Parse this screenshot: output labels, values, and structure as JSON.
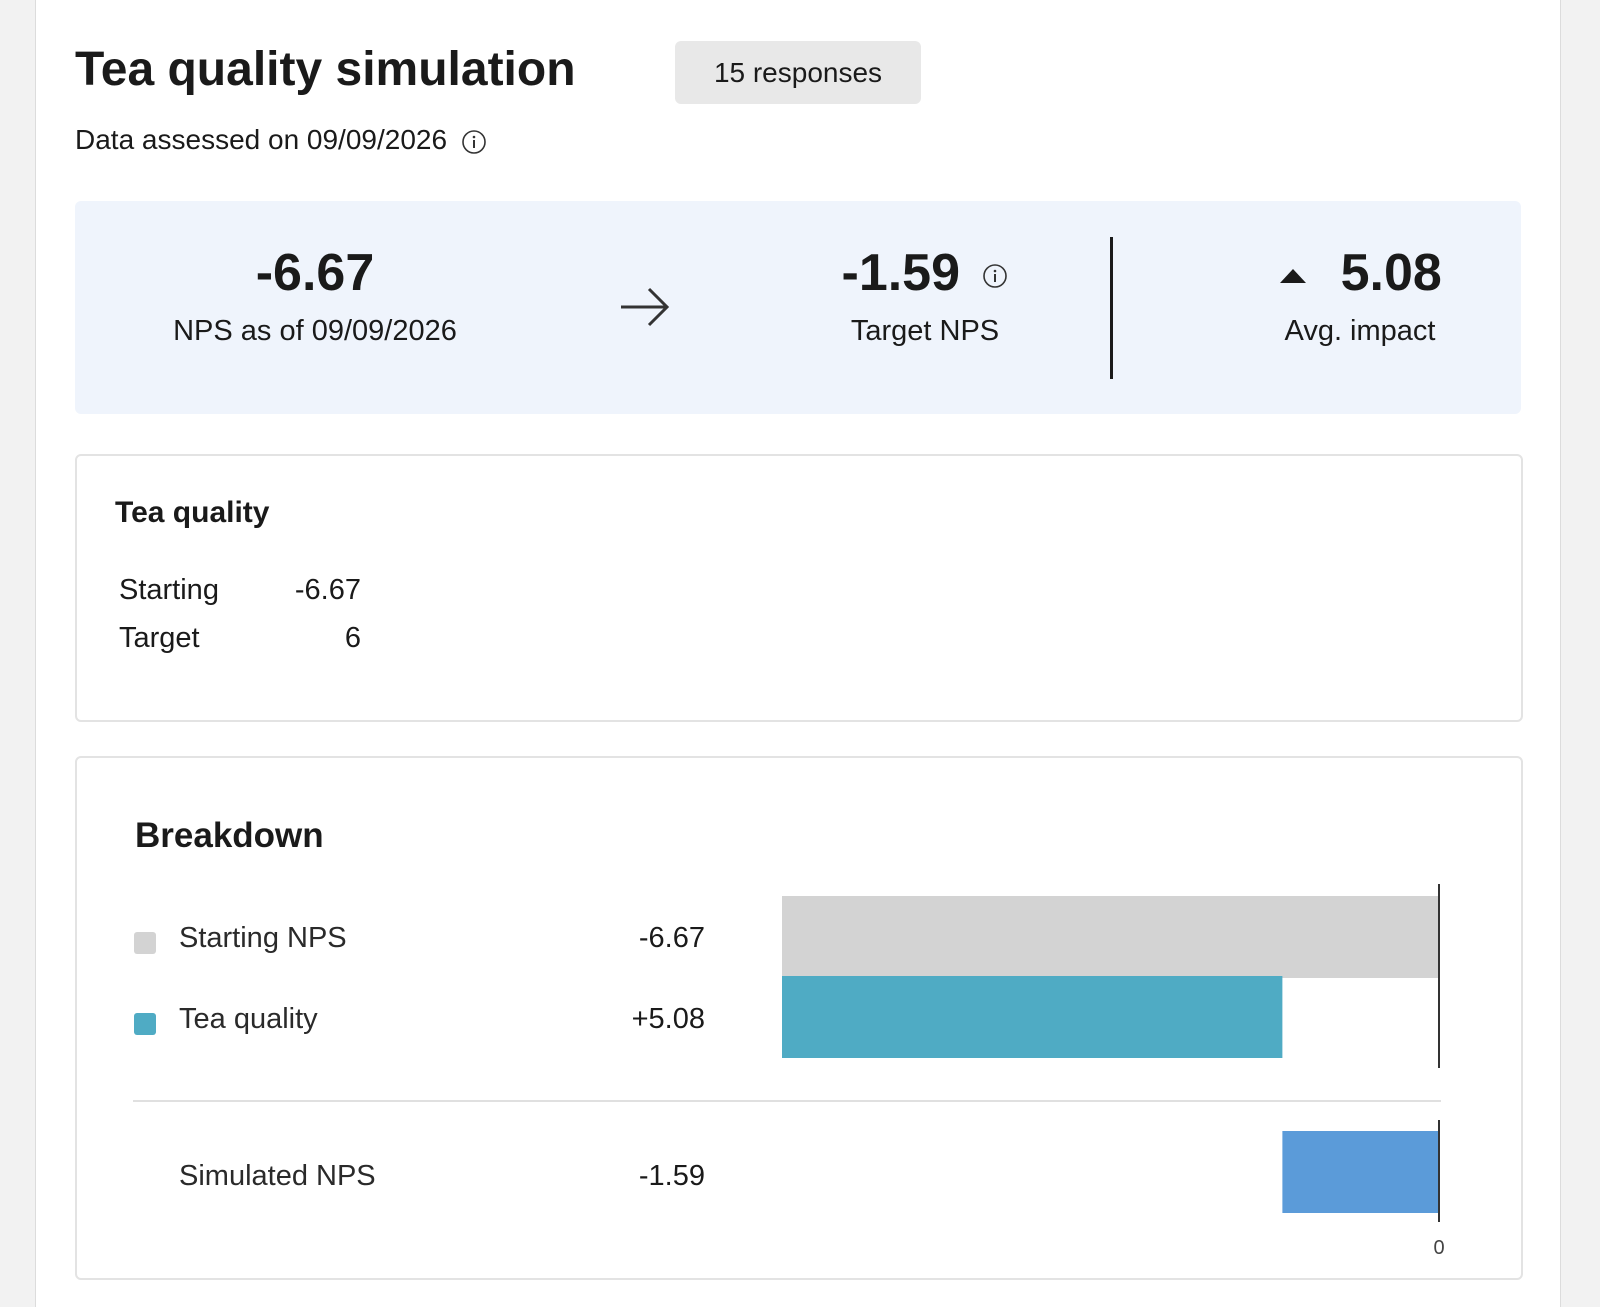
{
  "page": {
    "title": "Tea quality simulation",
    "responses_badge": "15 responses",
    "assessed_text": "Data assessed on 09/09/2026"
  },
  "summary": {
    "starting": {
      "value": "-6.67",
      "label": "NPS as of 09/09/2026"
    },
    "target": {
      "value": "-1.59",
      "label": "Target NPS"
    },
    "impact": {
      "value": "5.08",
      "label": "Avg. impact"
    }
  },
  "driver_card": {
    "title": "Tea quality",
    "rows": [
      {
        "label": "Starting",
        "value": "-6.67"
      },
      {
        "label": "Target",
        "value": "6"
      }
    ]
  },
  "breakdown": {
    "title": "Breakdown",
    "rows": [
      {
        "label": "Starting NPS",
        "value": "-6.67",
        "swatch": "#d3d3d3"
      },
      {
        "label": "Tea quality",
        "value": "+5.08",
        "swatch": "#4fabc4"
      }
    ],
    "total": {
      "label": "Simulated NPS",
      "value": "-1.59"
    }
  },
  "chart_data": {
    "type": "bar",
    "orientation": "horizontal-waterfall",
    "categories": [
      "Starting NPS",
      "Tea quality",
      "Simulated NPS"
    ],
    "bars": [
      {
        "name": "Starting NPS",
        "start": -6.67,
        "end": 0,
        "color": "#d3d3d3"
      },
      {
        "name": "Tea quality",
        "start": -6.67,
        "end": -1.59,
        "color": "#4fabc4"
      },
      {
        "name": "Simulated NPS",
        "start": -1.59,
        "end": 0,
        "color": "#5b9bd9"
      }
    ],
    "xlim": [
      -6.67,
      0
    ],
    "x_tick_labels": [
      "0"
    ],
    "grid": false
  },
  "colors": {
    "summary_bg": "#eff4fc",
    "starting_bar": "#d3d3d3",
    "impact_bar": "#4fabc4",
    "simulated_bar": "#5b9bd9"
  },
  "icons": {
    "info": "info-icon",
    "arrow": "arrow-right-icon",
    "caret": "caret-up-icon"
  }
}
